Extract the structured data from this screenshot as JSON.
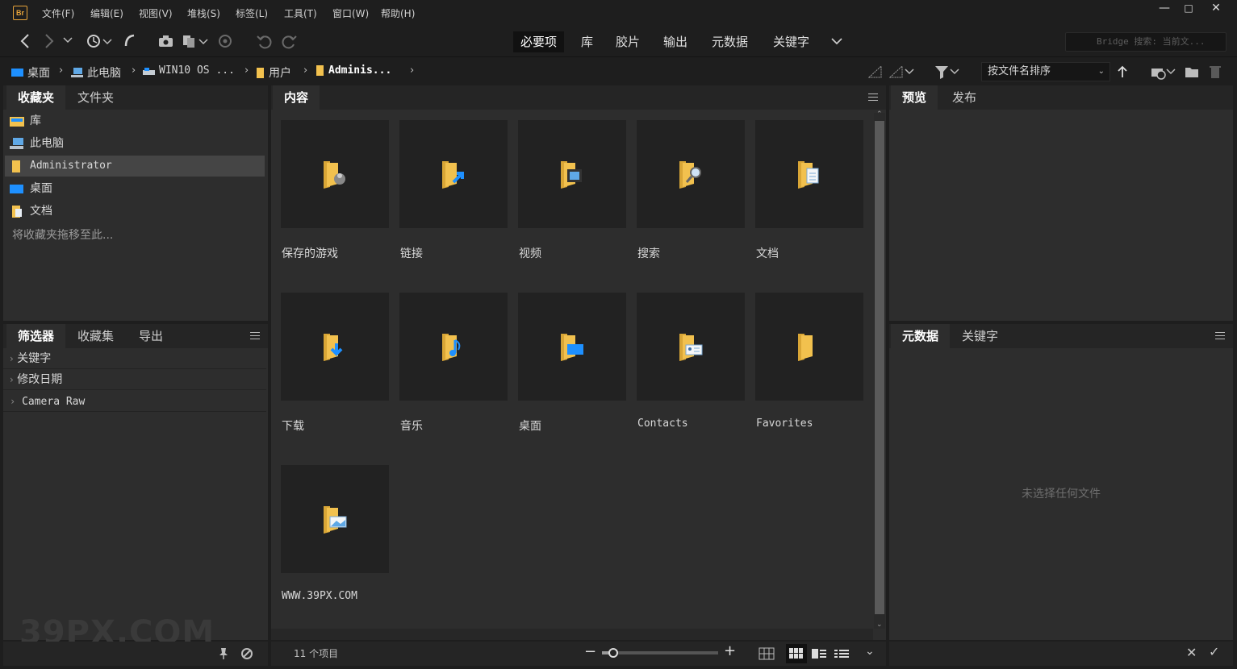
{
  "app": {
    "logo": "Br"
  },
  "menu": [
    "文件(F)",
    "编辑(E)",
    "视图(V)",
    "堆栈(S)",
    "标签(L)",
    "工具(T)",
    "窗口(W)",
    "帮助(H)"
  ],
  "workspaces": [
    "必要项",
    "库",
    "胶片",
    "输出",
    "元数据",
    "关键字"
  ],
  "search": {
    "placeholder": "Bridge 搜索: 当前文..."
  },
  "path": [
    "桌面",
    "此电脑",
    "WIN10 OS ...",
    "用户",
    "Adminis..."
  ],
  "sort": {
    "label": "按文件名排序"
  },
  "left_top": {
    "tabs": [
      "收藏夹",
      "文件夹"
    ],
    "favorites": [
      {
        "label": "库",
        "icon": "library-icon"
      },
      {
        "label": "此电脑",
        "icon": "computer-icon"
      },
      {
        "label": "Administrator",
        "icon": "folder-icon"
      },
      {
        "label": "桌面",
        "icon": "desktop-icon"
      },
      {
        "label": "文档",
        "icon": "documents-icon"
      }
    ],
    "hint": "将收藏夹拖移至此..."
  },
  "left_bottom": {
    "tabs": [
      "筛选器",
      "收藏集",
      "导出"
    ],
    "filters": [
      "关键字",
      "修改日期",
      "Camera Raw"
    ]
  },
  "content": {
    "tab": "内容",
    "items": [
      {
        "label": "保存的游戏",
        "icon": "saved-games-folder-icon"
      },
      {
        "label": "链接",
        "icon": "links-folder-icon"
      },
      {
        "label": "视频",
        "icon": "videos-folder-icon"
      },
      {
        "label": "搜索",
        "icon": "searches-folder-icon"
      },
      {
        "label": "文档",
        "icon": "documents-folder-icon"
      },
      {
        "label": "下载",
        "icon": "downloads-folder-icon"
      },
      {
        "label": "音乐",
        "icon": "music-folder-icon"
      },
      {
        "label": "桌面",
        "icon": "desktop-folder-icon"
      },
      {
        "label": "Contacts",
        "icon": "contacts-folder-icon"
      },
      {
        "label": "Favorites",
        "icon": "favorites-folder-icon"
      },
      {
        "label": "WWW.39PX.COM",
        "icon": "pictures-folder-icon"
      }
    ],
    "status": "11 个项目",
    "zoom": 0.1
  },
  "right_top": {
    "tabs": [
      "预览",
      "发布"
    ]
  },
  "right_bottom": {
    "tabs": [
      "元数据",
      "关键字"
    ],
    "empty": "未选择任何文件"
  },
  "watermark": "39PX.COM",
  "colors": {
    "folder": "#f2c14e",
    "accent_blue": "#1e90ff",
    "brand": "#e6a33a"
  }
}
